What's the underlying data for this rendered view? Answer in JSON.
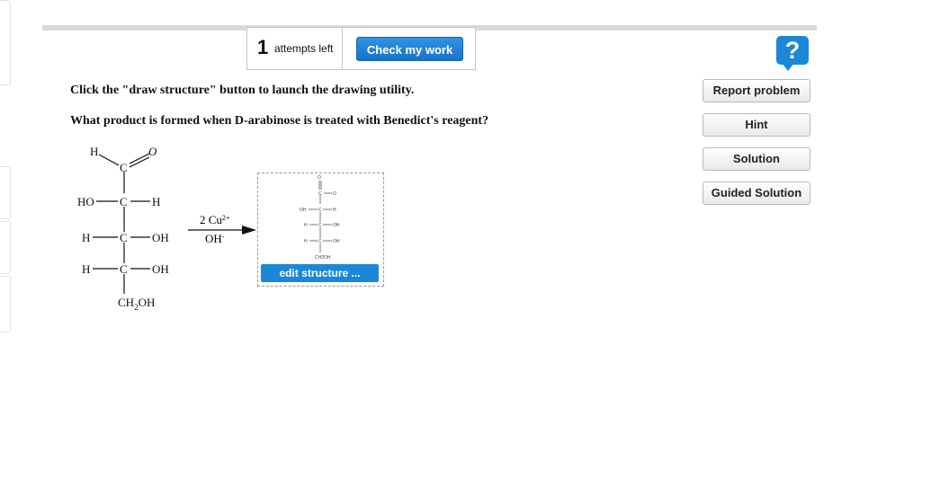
{
  "attempts": {
    "count": "1",
    "label": "attempts left"
  },
  "check_button": "Check my work",
  "help_icon_glyph": "?",
  "side_buttons": [
    "Report problem",
    "Hint",
    "Solution",
    "Guided Solution"
  ],
  "instructions": "Click the \"draw structure\" button to launch the drawing utility.",
  "question": "What product is formed when D-arabinose is treated with Benedict's reagent?",
  "reactant": {
    "top_h": "H",
    "top_c": "C",
    "top_o": "O",
    "c": "C",
    "ho": "HO",
    "h": "H",
    "oh": "OH",
    "ch2oh_ch": "CH",
    "ch2oh_sub": "2",
    "ch2oh_oh": "OH"
  },
  "reagent": {
    "cu_base": "2 Cu",
    "cu_charge": "2+",
    "oh_base": "OH",
    "oh_charge": "-"
  },
  "product_preview": {
    "top_o": "O",
    "top_c": "C",
    "o_minus": "O",
    "oh": "OH",
    "h": "H",
    "c": "C",
    "ch2oh": "CH2OH"
  },
  "edit_button": "edit structure ...",
  "colors": {
    "accent": "#1a88d6",
    "button_text": "#ffffff"
  }
}
